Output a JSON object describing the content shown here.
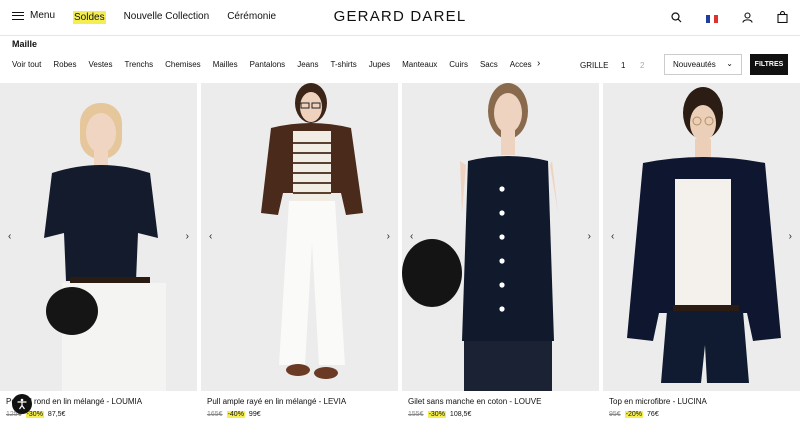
{
  "header": {
    "menu_label": "Menu",
    "nav": [
      "Soldes",
      "Nouvelle Collection",
      "Cérémonie"
    ],
    "logo": "GERARD DAREL"
  },
  "category": {
    "title": "Maille",
    "items": [
      "Voir tout",
      "Robes",
      "Vestes",
      "Trenchs",
      "Chemises",
      "Mailles",
      "Pantalons",
      "Jeans",
      "T-shirts",
      "Jupes",
      "Manteaux",
      "Cuirs",
      "Sacs",
      "Accessoires"
    ],
    "active": "Mailles"
  },
  "controls": {
    "grid_label": "GRILLE",
    "grid_options": [
      "1",
      "2"
    ],
    "sort_value": "Nouveautés",
    "filters_label": "FILTRES"
  },
  "products": [
    {
      "name": "Pull col rond en lin mélangé - LOUMIA",
      "old_price": "125€",
      "discount": "-30%",
      "price": "87,5€"
    },
    {
      "name": "Pull ample rayé en lin mélangé - LEVIA",
      "old_price": "165€",
      "discount": "-40%",
      "price": "99€"
    },
    {
      "name": "Gilet sans manche en coton - LOUVE",
      "old_price": "155€",
      "discount": "-30%",
      "price": "108,5€"
    },
    {
      "name": "Top en microfibre - LUCINA",
      "old_price": "95€",
      "discount": "-20%",
      "price": "76€"
    }
  ],
  "colors": {
    "sale_highlight": "#f5ee52",
    "primary": "#111111",
    "photo_bg": "#ededed"
  }
}
